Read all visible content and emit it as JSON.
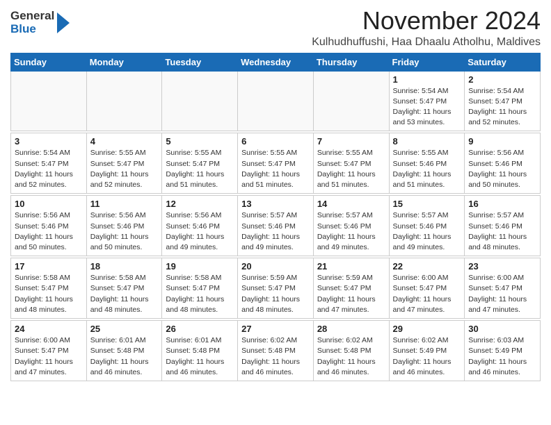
{
  "header": {
    "logo_general": "General",
    "logo_blue": "Blue",
    "month_title": "November 2024",
    "location": "Kulhudhuffushi, Haa Dhaalu Atholhu, Maldives"
  },
  "days_of_week": [
    "Sunday",
    "Monday",
    "Tuesday",
    "Wednesday",
    "Thursday",
    "Friday",
    "Saturday"
  ],
  "weeks": [
    [
      {
        "day": "",
        "info": ""
      },
      {
        "day": "",
        "info": ""
      },
      {
        "day": "",
        "info": ""
      },
      {
        "day": "",
        "info": ""
      },
      {
        "day": "",
        "info": ""
      },
      {
        "day": "1",
        "info": "Sunrise: 5:54 AM\nSunset: 5:47 PM\nDaylight: 11 hours and 53 minutes."
      },
      {
        "day": "2",
        "info": "Sunrise: 5:54 AM\nSunset: 5:47 PM\nDaylight: 11 hours and 52 minutes."
      }
    ],
    [
      {
        "day": "3",
        "info": "Sunrise: 5:54 AM\nSunset: 5:47 PM\nDaylight: 11 hours and 52 minutes."
      },
      {
        "day": "4",
        "info": "Sunrise: 5:55 AM\nSunset: 5:47 PM\nDaylight: 11 hours and 52 minutes."
      },
      {
        "day": "5",
        "info": "Sunrise: 5:55 AM\nSunset: 5:47 PM\nDaylight: 11 hours and 51 minutes."
      },
      {
        "day": "6",
        "info": "Sunrise: 5:55 AM\nSunset: 5:47 PM\nDaylight: 11 hours and 51 minutes."
      },
      {
        "day": "7",
        "info": "Sunrise: 5:55 AM\nSunset: 5:47 PM\nDaylight: 11 hours and 51 minutes."
      },
      {
        "day": "8",
        "info": "Sunrise: 5:55 AM\nSunset: 5:46 PM\nDaylight: 11 hours and 51 minutes."
      },
      {
        "day": "9",
        "info": "Sunrise: 5:56 AM\nSunset: 5:46 PM\nDaylight: 11 hours and 50 minutes."
      }
    ],
    [
      {
        "day": "10",
        "info": "Sunrise: 5:56 AM\nSunset: 5:46 PM\nDaylight: 11 hours and 50 minutes."
      },
      {
        "day": "11",
        "info": "Sunrise: 5:56 AM\nSunset: 5:46 PM\nDaylight: 11 hours and 50 minutes."
      },
      {
        "day": "12",
        "info": "Sunrise: 5:56 AM\nSunset: 5:46 PM\nDaylight: 11 hours and 49 minutes."
      },
      {
        "day": "13",
        "info": "Sunrise: 5:57 AM\nSunset: 5:46 PM\nDaylight: 11 hours and 49 minutes."
      },
      {
        "day": "14",
        "info": "Sunrise: 5:57 AM\nSunset: 5:46 PM\nDaylight: 11 hours and 49 minutes."
      },
      {
        "day": "15",
        "info": "Sunrise: 5:57 AM\nSunset: 5:46 PM\nDaylight: 11 hours and 49 minutes."
      },
      {
        "day": "16",
        "info": "Sunrise: 5:57 AM\nSunset: 5:46 PM\nDaylight: 11 hours and 48 minutes."
      }
    ],
    [
      {
        "day": "17",
        "info": "Sunrise: 5:58 AM\nSunset: 5:47 PM\nDaylight: 11 hours and 48 minutes."
      },
      {
        "day": "18",
        "info": "Sunrise: 5:58 AM\nSunset: 5:47 PM\nDaylight: 11 hours and 48 minutes."
      },
      {
        "day": "19",
        "info": "Sunrise: 5:58 AM\nSunset: 5:47 PM\nDaylight: 11 hours and 48 minutes."
      },
      {
        "day": "20",
        "info": "Sunrise: 5:59 AM\nSunset: 5:47 PM\nDaylight: 11 hours and 48 minutes."
      },
      {
        "day": "21",
        "info": "Sunrise: 5:59 AM\nSunset: 5:47 PM\nDaylight: 11 hours and 47 minutes."
      },
      {
        "day": "22",
        "info": "Sunrise: 6:00 AM\nSunset: 5:47 PM\nDaylight: 11 hours and 47 minutes."
      },
      {
        "day": "23",
        "info": "Sunrise: 6:00 AM\nSunset: 5:47 PM\nDaylight: 11 hours and 47 minutes."
      }
    ],
    [
      {
        "day": "24",
        "info": "Sunrise: 6:00 AM\nSunset: 5:47 PM\nDaylight: 11 hours and 47 minutes."
      },
      {
        "day": "25",
        "info": "Sunrise: 6:01 AM\nSunset: 5:48 PM\nDaylight: 11 hours and 46 minutes."
      },
      {
        "day": "26",
        "info": "Sunrise: 6:01 AM\nSunset: 5:48 PM\nDaylight: 11 hours and 46 minutes."
      },
      {
        "day": "27",
        "info": "Sunrise: 6:02 AM\nSunset: 5:48 PM\nDaylight: 11 hours and 46 minutes."
      },
      {
        "day": "28",
        "info": "Sunrise: 6:02 AM\nSunset: 5:48 PM\nDaylight: 11 hours and 46 minutes."
      },
      {
        "day": "29",
        "info": "Sunrise: 6:02 AM\nSunset: 5:49 PM\nDaylight: 11 hours and 46 minutes."
      },
      {
        "day": "30",
        "info": "Sunrise: 6:03 AM\nSunset: 5:49 PM\nDaylight: 11 hours and 46 minutes."
      }
    ]
  ]
}
